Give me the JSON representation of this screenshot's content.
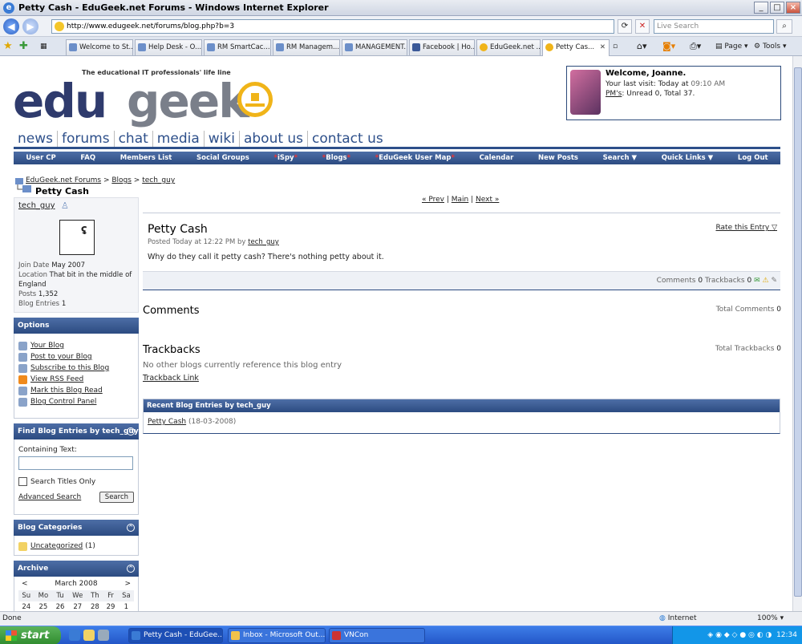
{
  "window": {
    "title": "Petty Cash - EduGeek.net Forums - Windows Internet Explorer"
  },
  "address": {
    "url": "http://www.edugeek.net/forums/blog.php?b=3",
    "search_placeholder": "Live Search"
  },
  "tabs": [
    {
      "label": "Welcome to St..."
    },
    {
      "label": "Help Desk - O..."
    },
    {
      "label": "RM SmartCac..."
    },
    {
      "label": "RM Managem..."
    },
    {
      "label": "MANAGEMENT..."
    },
    {
      "label": "Facebook | Ho..."
    },
    {
      "label": "EduGeek.net ..."
    },
    {
      "label": "Petty Cas..."
    }
  ],
  "commands": {
    "page": "Page",
    "tools": "Tools"
  },
  "logo": {
    "tagline": "The educational IT professionals' life line",
    "edu": "edu",
    "geek": "geek"
  },
  "welcome": {
    "greeting": "Welcome, Joanne.",
    "last_visit_label": "Your last visit: Today at",
    "last_visit_time": "09:10 AM",
    "pms_label": "PM's",
    "pms_text": ": Unread 0, Total 37."
  },
  "mainnav": [
    "news",
    "forums",
    "chat",
    "media",
    "wiki",
    "about us",
    "contact us"
  ],
  "subnav": [
    {
      "label": "User CP",
      "star": false
    },
    {
      "label": "FAQ",
      "star": false
    },
    {
      "label": "Members List",
      "star": false
    },
    {
      "label": "Social Groups",
      "star": false
    },
    {
      "label": "iSpy",
      "star": true
    },
    {
      "label": "Blogs",
      "star": true
    },
    {
      "label": "EduGeek User Map",
      "star": true
    },
    {
      "label": "Calendar",
      "star": false
    },
    {
      "label": "New Posts",
      "star": false
    },
    {
      "label": "Search ▼",
      "star": false
    },
    {
      "label": "Quick Links ▼",
      "star": false
    },
    {
      "label": "Log Out",
      "star": false
    }
  ],
  "breadcrumb": {
    "root": "EduGeek.net Forums",
    "blogs": "Blogs",
    "user": "tech_guy",
    "title": "Petty Cash"
  },
  "pager": {
    "prev": "« Prev",
    "main": "Main",
    "next": "Next »"
  },
  "profile": {
    "name": "tech_guy",
    "join_label": "Join Date",
    "join_value": "May 2007",
    "location_label": "Location",
    "location_value": "That bit in the middle of England",
    "posts_label": "Posts",
    "posts_value": "1,352",
    "entries_label": "Blog Entries",
    "entries_value": "1"
  },
  "options": {
    "title": "Options",
    "items": [
      "Your Blog",
      "Post to your Blog",
      "Subscribe to this Blog",
      "View RSS Feed",
      "Mark this Blog Read",
      "Blog Control Panel"
    ]
  },
  "find": {
    "title": "Find Blog Entries by tech_guy",
    "containing": "Containing Text:",
    "titles_only": "Search Titles Only",
    "advanced": "Advanced Search",
    "button": "Search"
  },
  "categories": {
    "title": "Blog Categories",
    "item": "Uncategorized",
    "count": "(1)"
  },
  "archive": {
    "title": "Archive",
    "prev": "<",
    "month": "March 2008",
    "next": ">",
    "days": [
      "Su",
      "Mo",
      "Tu",
      "We",
      "Th",
      "Fr",
      "Sa"
    ],
    "row": [
      "24",
      "25",
      "26",
      "27",
      "28",
      "29",
      "1"
    ]
  },
  "entry": {
    "title": "Petty Cash",
    "posted": "Posted Today at 12:22 PM by",
    "author": "tech_guy",
    "body": "Why do they call it petty cash? There's nothing petty about it.",
    "rate": "Rate this Entry",
    "comments_label": "Comments",
    "comments_value": "0",
    "trackbacks_label": "Trackbacks",
    "trackbacks_value": "0"
  },
  "comments": {
    "title": "Comments",
    "total_label": "Total Comments",
    "total_value": "0"
  },
  "trackbacks": {
    "title": "Trackbacks",
    "total_label": "Total Trackbacks",
    "total_value": "0",
    "none": "No other blogs currently reference this blog entry",
    "link": "Trackback Link"
  },
  "recent": {
    "title": "Recent Blog Entries by tech_guy",
    "item": "Petty Cash",
    "date": "(18-03-2008)"
  },
  "status": {
    "text": "Done",
    "zone": "Internet",
    "zoom": "100%"
  },
  "taskbar": {
    "start": "start",
    "tasks": [
      "Petty Cash - EduGee...",
      "Inbox - Microsoft Out...",
      "VNCon"
    ],
    "clock": "12:34"
  }
}
